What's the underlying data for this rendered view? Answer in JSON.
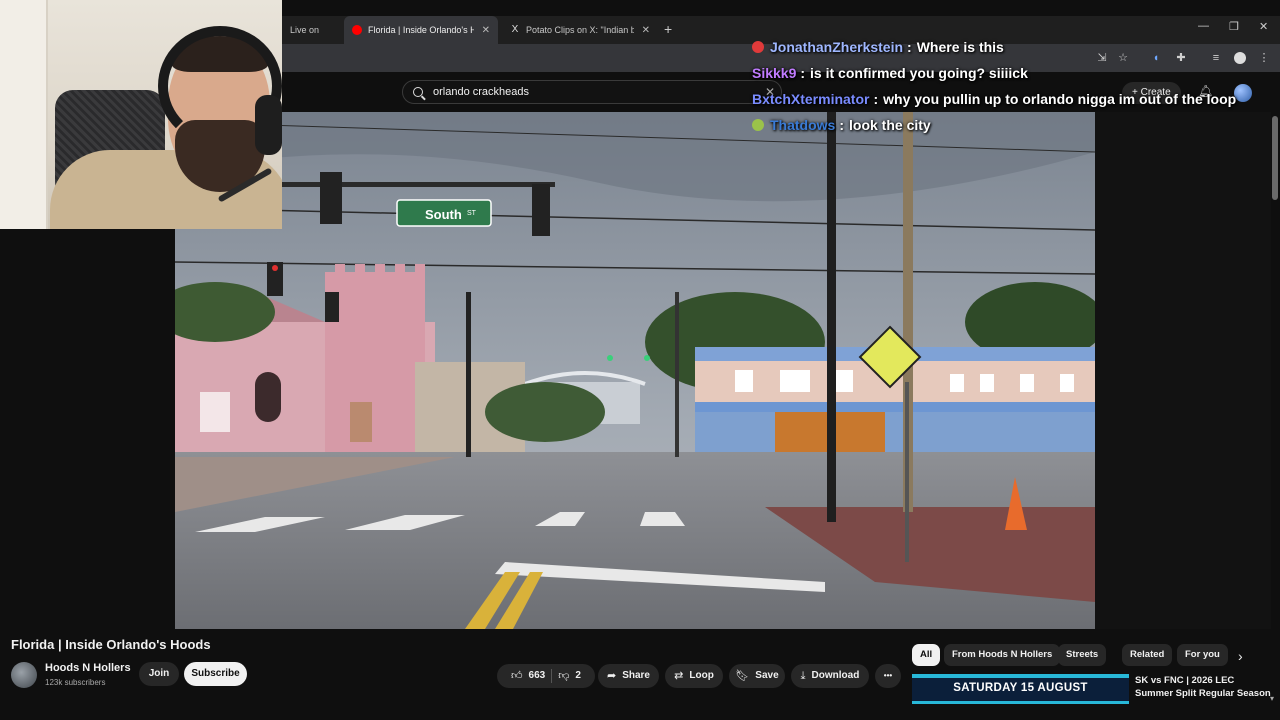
{
  "browser": {
    "tabs": [
      {
        "title": "Live on",
        "favicon": "kick-icon"
      },
      {
        "title": "Florida | Inside Orlando's Hoods",
        "favicon": "youtube-icon"
      },
      {
        "title": "Potato Clips on X: \"Indian begg",
        "favicon": "x-icon"
      }
    ],
    "newtab": "+",
    "window_controls": [
      "—",
      "❐",
      "✕"
    ]
  },
  "youtube": {
    "search": {
      "value": "orlando crackheads",
      "clear": "✕"
    },
    "create_label": "+ Create"
  },
  "chat": [
    {
      "user": "JonathanZherkstein",
      "message": "Where is this",
      "color": "#9fb7ff",
      "badge": "#e03a3a"
    },
    {
      "user": "Sikkk9",
      "message": "is it confirmed you going? siiiick",
      "color": "#c07bff",
      "badge": ""
    },
    {
      "user": "BxtchXterminator",
      "message": "why you pullin up to orlando nigga im out of the loop",
      "color": "#7a8cff",
      "badge": ""
    },
    {
      "user": "Thatdows",
      "message": "look the city",
      "color": "#3a7bd5",
      "badge": "#9bc24a"
    }
  ],
  "video": {
    "title": "Florida | Inside Orlando's Hoods",
    "street_sign": "South",
    "street_sign_suffix": "ST"
  },
  "channel": {
    "name": "Hoods N Hollers",
    "subscribers": "123k subscribers",
    "join_label": "Join",
    "subscribe_label": "Subscribe"
  },
  "actions": {
    "likes": "663",
    "dislikes": "2",
    "share": "Share",
    "loop": "Loop",
    "save": "Save",
    "download": "Download",
    "more": "•••"
  },
  "chips": [
    "All",
    "From Hoods N Hollers",
    "Streets",
    "Related",
    "For you"
  ],
  "related": {
    "thumbnail_text": "SATURDAY 15 AUGUST",
    "title_line1": "SK vs FNC  | 2026 LEC",
    "title_line2": "Summer Split Regular Season"
  }
}
